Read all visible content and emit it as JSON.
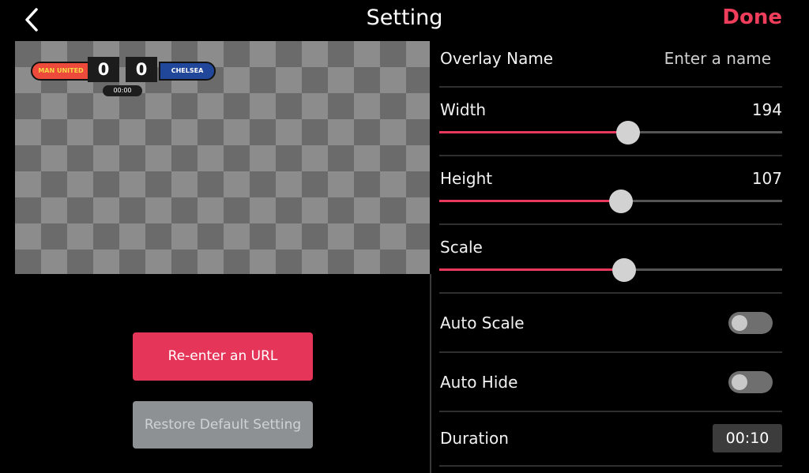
{
  "header": {
    "title": "Setting",
    "done_label": "Done"
  },
  "preview": {
    "team_left": "MAN UNITED",
    "team_right": "CHELSEA",
    "score_left": "0",
    "score_right": "0",
    "timer": "00:00"
  },
  "buttons": {
    "reenter_url": "Re-enter an URL",
    "restore_default": "Restore Default Setting"
  },
  "settings": {
    "overlay_name_label": "Overlay Name",
    "overlay_name_value": "",
    "overlay_name_placeholder": "Enter a name",
    "width_label": "Width",
    "width_value": "194",
    "width_fraction": 0.55,
    "height_label": "Height",
    "height_value": "107",
    "height_fraction": 0.53,
    "scale_label": "Scale",
    "scale_fraction": 0.54,
    "auto_scale_label": "Auto Scale",
    "auto_scale_on": false,
    "auto_hide_label": "Auto Hide",
    "auto_hide_on": false,
    "duration_label": "Duration",
    "duration_value": "00:10"
  },
  "colors": {
    "accent": "#e8385b",
    "background": "#000000"
  }
}
